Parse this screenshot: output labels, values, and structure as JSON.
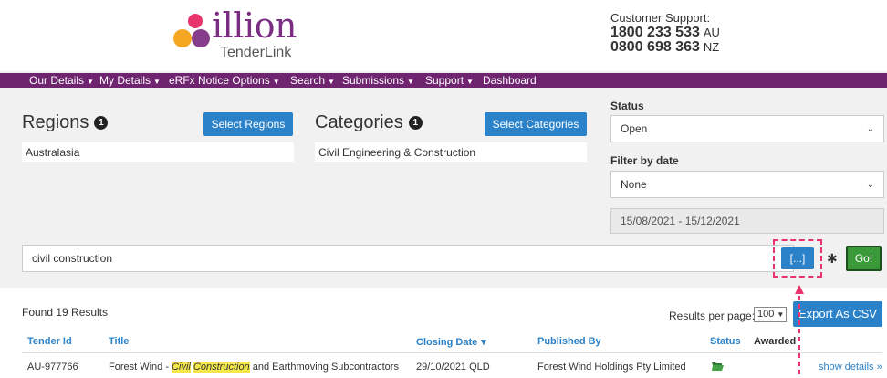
{
  "header": {
    "logo_text": "illion",
    "logo_sub": "TenderLink",
    "support_title": "Customer Support:",
    "phone_au": "1800 233 533",
    "phone_au_cc": "AU",
    "phone_nz": "0800 698 363",
    "phone_nz_cc": "NZ"
  },
  "nav": {
    "items": [
      "Our Details",
      "My Details",
      "eRFx Notice Options",
      "Search",
      "Submissions",
      "Support",
      "Dashboard"
    ]
  },
  "regions": {
    "title": "Regions",
    "count": "1",
    "button": "Select Regions",
    "value": "Australasia"
  },
  "categories": {
    "title": "Categories",
    "count": "1",
    "button": "Select Categories",
    "value": "Civil Engineering & Construction"
  },
  "filters": {
    "status_label": "Status",
    "status_value": "Open",
    "date_label": "Filter by date",
    "date_value": "None",
    "date_range": "15/08/2021 - 15/12/2021"
  },
  "search": {
    "query": "civil construction",
    "advanced_button": "[...]",
    "clear_icon": "✱",
    "go_button": "Go!"
  },
  "results": {
    "found": "Found 19 Results",
    "per_page_label": "Results per page:",
    "per_page_value": "100",
    "export_button": "Export As CSV",
    "columns": [
      "Tender Id",
      "Title",
      "Closing Date",
      "Published By",
      "Status",
      "Awarded"
    ],
    "rows": [
      {
        "id": "AU-977766",
        "title_pre": "Forest Wind - ",
        "title_hl1": "Civil",
        "title_hl2": "Construction",
        "title_post": " and Earthmoving Subcontractors",
        "closing": "29/10/2021 QLD",
        "publisher": "Forest Wind Holdings Pty Limited",
        "status_icon": "folder-open-icon",
        "details": "show details »"
      }
    ]
  },
  "colors": {
    "nav": "#6f2470",
    "accent": "#2c82c9",
    "go": "#3a9a3a",
    "highlight": "#e8336d"
  }
}
